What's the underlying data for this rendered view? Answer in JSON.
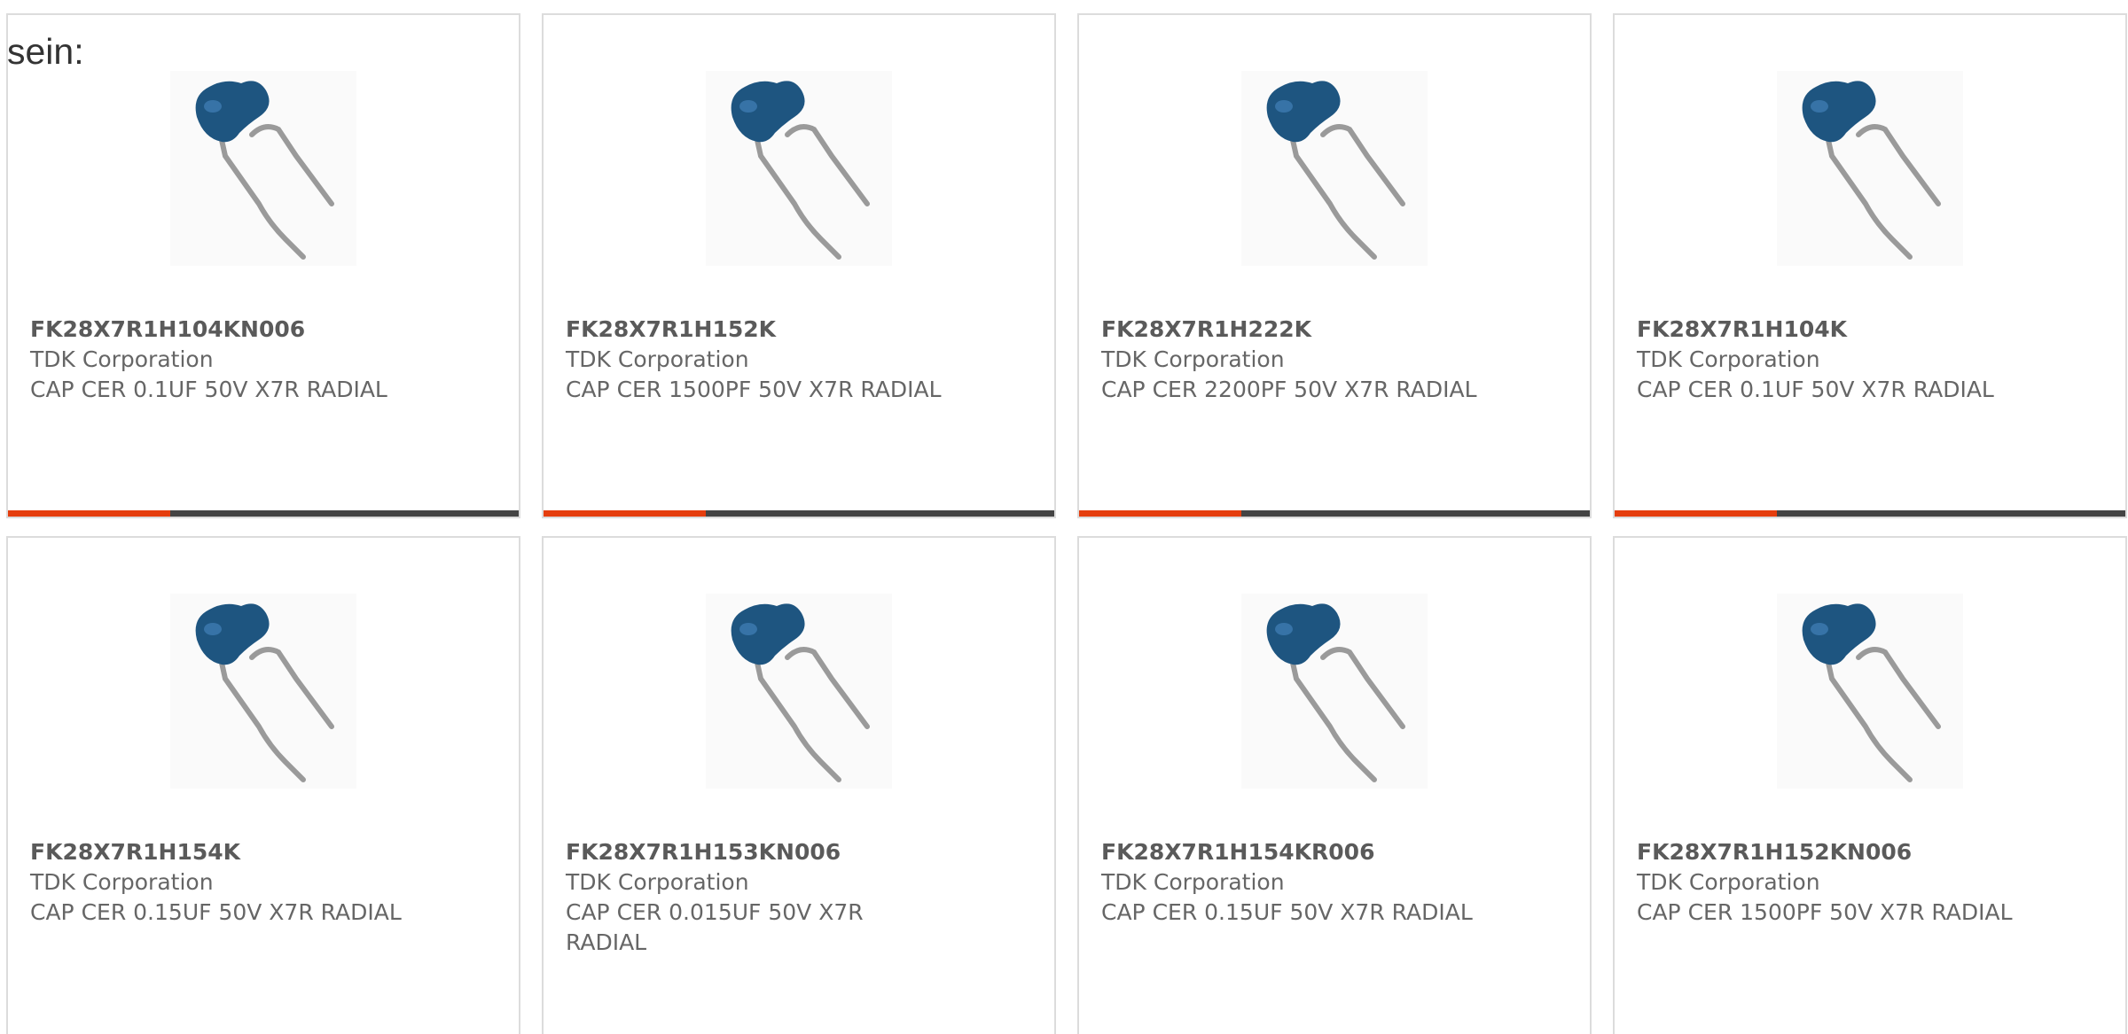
{
  "lead_text": "sein:",
  "colors": {
    "accent_bar": "#e53e0e",
    "bar_base": "#444444",
    "capacitor_body": "#1e5580",
    "lead_wire": "#9a9a9a"
  },
  "image_icon": "ceramic-capacitor-radial",
  "products": [
    {
      "part_number": "FK28X7R1H104KN006",
      "manufacturer": "TDK Corporation",
      "description": "CAP CER 0.1UF 50V X7R RADIAL"
    },
    {
      "part_number": "FK28X7R1H152K",
      "manufacturer": "TDK Corporation",
      "description": "CAP CER 1500PF 50V X7R RADIAL"
    },
    {
      "part_number": "FK28X7R1H222K",
      "manufacturer": "TDK Corporation",
      "description": "CAP CER 2200PF 50V X7R RADIAL"
    },
    {
      "part_number": "FK28X7R1H104K",
      "manufacturer": "TDK Corporation",
      "description": "CAP CER 0.1UF 50V X7R RADIAL"
    },
    {
      "part_number": "FK28X7R1H154K",
      "manufacturer": "TDK Corporation",
      "description": "CAP CER 0.15UF 50V X7R RADIAL"
    },
    {
      "part_number": "FK28X7R1H153KN006",
      "manufacturer": "TDK Corporation",
      "description": "CAP CER 0.015UF 50V X7R RADIAL"
    },
    {
      "part_number": "FK28X7R1H154KR006",
      "manufacturer": "TDK Corporation",
      "description": "CAP CER 0.15UF 50V X7R RADIAL"
    },
    {
      "part_number": "FK28X7R1H152KN006",
      "manufacturer": "TDK Corporation",
      "description": "CAP CER 1500PF 50V X7R RADIAL"
    }
  ]
}
